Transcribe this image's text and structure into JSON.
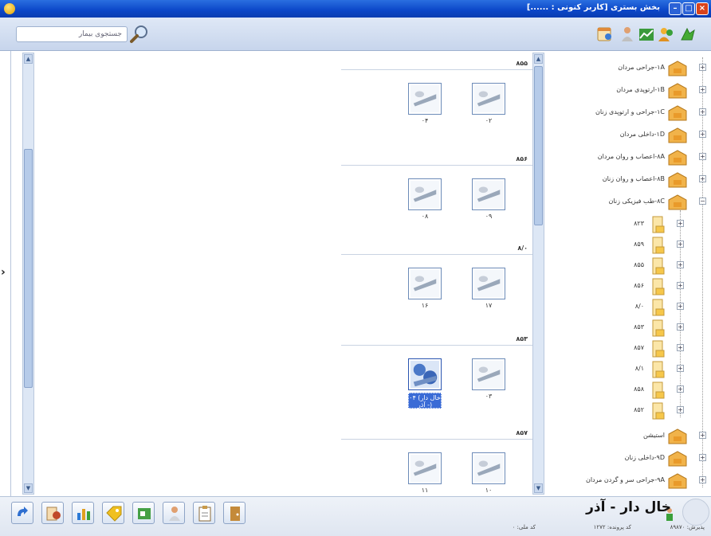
{
  "window": {
    "title": "بخش بستری [کاربر کنونی : ......]",
    "buttons": [
      "close",
      "maximize",
      "minimize"
    ]
  },
  "toolbar": {
    "search_placeholder": "جستجوی بیمار",
    "icons": [
      "search-icon",
      "calendar-person-icon",
      "person-icon",
      "chart-icon",
      "users-icon",
      "green-arrow-icon"
    ]
  },
  "content": {
    "groups": [
      {
        "label": "۸۵۵",
        "items": [
          {
            "label": "۰۲",
            "selected": false
          },
          {
            "label": "۰۴",
            "selected": false
          }
        ]
      },
      {
        "label": "۸۵۶",
        "items": [
          {
            "label": "۰۹",
            "selected": false
          },
          {
            "label": "۰۸",
            "selected": false
          }
        ]
      },
      {
        "label": "۸/۰",
        "items": [
          {
            "label": "۱۷",
            "selected": false
          },
          {
            "label": "۱۶",
            "selected": false
          }
        ]
      },
      {
        "label": "۸۵۳",
        "items": [
          {
            "label": "۰۳",
            "selected": false
          },
          {
            "label": "۰۴ (خال دار - آذر)",
            "selected": true
          }
        ]
      },
      {
        "label": "۸۵۷",
        "items": [
          {
            "label": "۱۰",
            "selected": false
          },
          {
            "label": "۱۱",
            "selected": false
          }
        ]
      }
    ]
  },
  "tree": {
    "sections": [
      {
        "label": "۱A-جراحی مردان",
        "expanded": false
      },
      {
        "label": "۱B-ارتوپدی مردان",
        "expanded": false
      },
      {
        "label": "۱C-جراحی و ارتوپدی زنان",
        "expanded": false
      },
      {
        "label": "۱D-داخلی مردان",
        "expanded": false
      },
      {
        "label": "۸A-اعصاب و روان مردان",
        "expanded": false
      },
      {
        "label": "۸B-اعصاب و روان زنان",
        "expanded": false
      },
      {
        "label": "۸C-طب فیزیکی زنان",
        "expanded": true
      },
      {
        "label": "استیشن",
        "expanded": false
      },
      {
        "label": "۹D-داخلی زنان",
        "expanded": false
      },
      {
        "label": "۹A-جراحی سر و گردن مردان",
        "expanded": false
      }
    ],
    "rooms": [
      "۸۲۳",
      "۸۵۹",
      "۸۵۵",
      "۸۵۶",
      "۸/۰",
      "۸۵۳",
      "۸۵۷",
      "۸/۱",
      "۸۵۸",
      "۸۵۲"
    ]
  },
  "bottom": {
    "patient_name": "خال دار - آذر",
    "admission": "پذیرش: ۸۹۸۷۰",
    "file_no": "کد پرونده: ۱۲۷۲",
    "national_code": "کد ملی: ۰"
  },
  "colors": {
    "titlebar": "#0b46c8",
    "selection": "#3a6bd6",
    "toolbar_bg": "#c7d5ec"
  }
}
